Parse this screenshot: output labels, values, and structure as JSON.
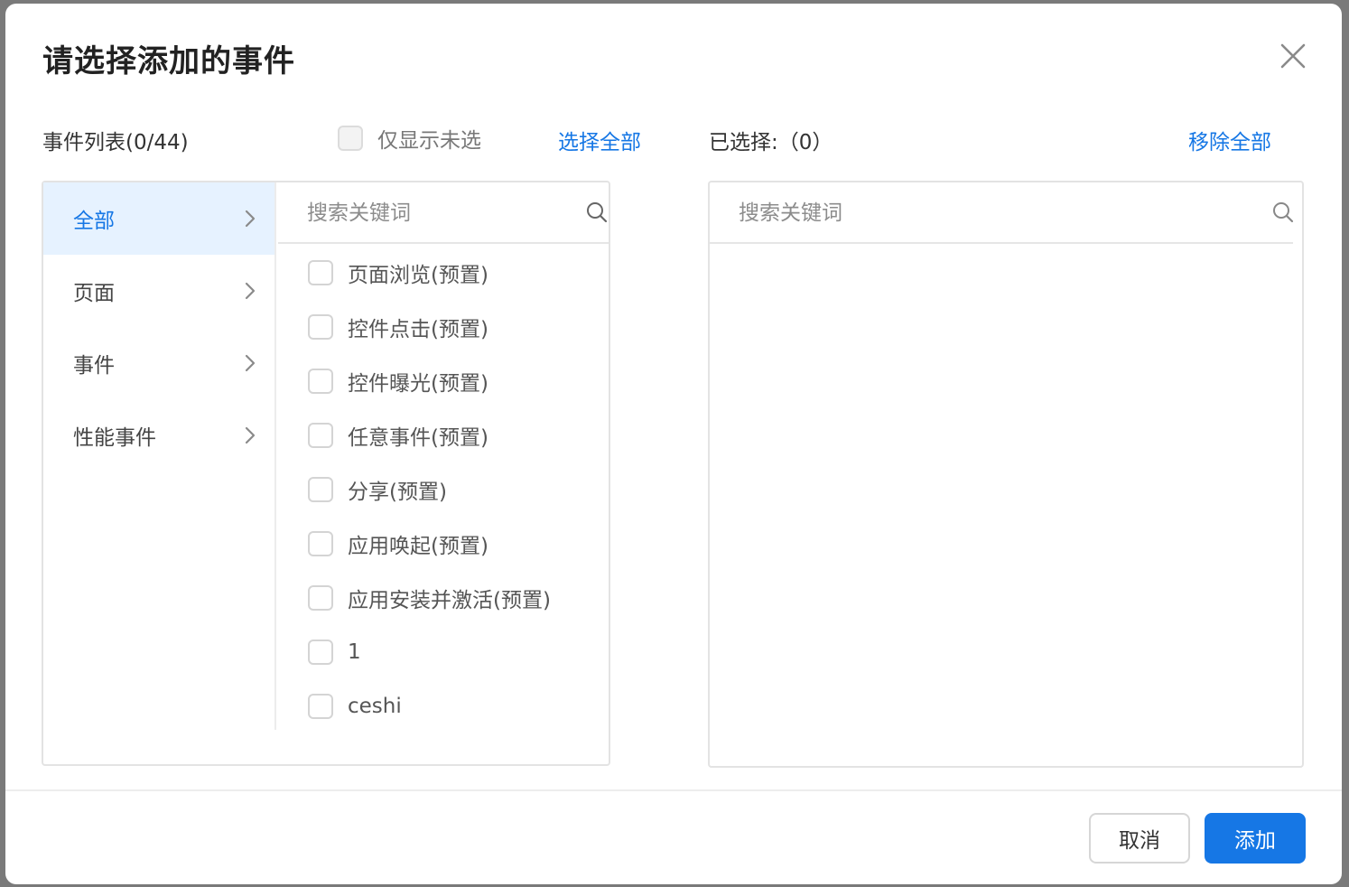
{
  "dialog": {
    "title": "请选择添加的事件",
    "close_icon": "close-icon"
  },
  "toolbar": {
    "event_list_label": "事件列表(0/44)",
    "only_unselected_label": "仅显示未选",
    "only_unselected_checked": false,
    "select_all_label": "选择全部",
    "selected_label": "已选择:（0）",
    "remove_all_label": "移除全部"
  },
  "categories": [
    {
      "label": "全部",
      "active": true
    },
    {
      "label": "页面",
      "active": false
    },
    {
      "label": "事件",
      "active": false
    },
    {
      "label": "性能事件",
      "active": false
    }
  ],
  "left_search": {
    "placeholder": "搜索关键词",
    "value": ""
  },
  "right_search": {
    "placeholder": "搜索关键词",
    "value": ""
  },
  "events": [
    {
      "label": "页面浏览(预置)",
      "checked": false
    },
    {
      "label": "控件点击(预置)",
      "checked": false
    },
    {
      "label": "控件曝光(预置)",
      "checked": false
    },
    {
      "label": "任意事件(预置)",
      "checked": false
    },
    {
      "label": "分享(预置)",
      "checked": false
    },
    {
      "label": "应用唤起(预置)",
      "checked": false
    },
    {
      "label": "应用安装并激活(预置)",
      "checked": false
    },
    {
      "label": "1",
      "checked": false
    },
    {
      "label": "ceshi",
      "checked": false
    }
  ],
  "selected_events": [],
  "footer": {
    "cancel_label": "取消",
    "add_label": "添加"
  },
  "colors": {
    "accent": "#1677e5",
    "active_bg": "#e6f2ff"
  }
}
